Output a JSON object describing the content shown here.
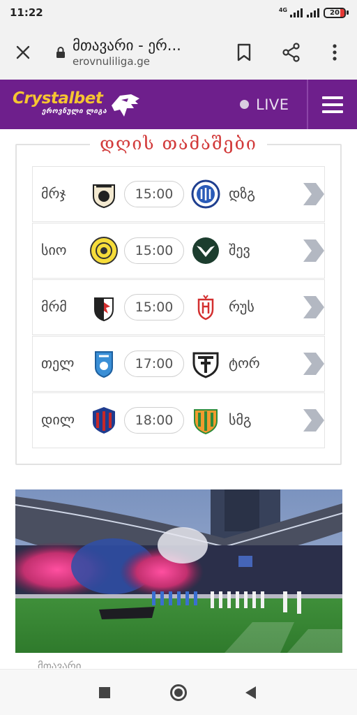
{
  "status_bar": {
    "time": "11:22",
    "network": "4G",
    "battery": "20"
  },
  "browser": {
    "page_title": "მთავარი - ერ...",
    "url": "erovnuliliga.ge"
  },
  "site_header": {
    "brand": "Crystalbet",
    "brand_subtitle": "ეროვნული ლიგა",
    "live_label": "LIVE",
    "colors": {
      "header_bg": "#6e1f8c",
      "brand_yellow": "#f6c531"
    }
  },
  "matches": {
    "title": "დღის თამაშები",
    "rows": [
      {
        "home": "მრჯ",
        "time": "15:00",
        "away": "დზგ"
      },
      {
        "home": "სიო",
        "time": "15:00",
        "away": "შევ"
      },
      {
        "home": "მრმ",
        "time": "15:00",
        "away": "რუს"
      },
      {
        "home": "თელ",
        "time": "17:00",
        "away": "ტორ"
      },
      {
        "home": "დილ",
        "time": "18:00",
        "away": "სმგ"
      }
    ]
  },
  "photo": {
    "icon": "stadium-photo"
  },
  "below_photo_label": "მთავარი",
  "nav": {
    "icons": [
      "recents-square-icon",
      "home-circle-icon",
      "back-triangle-icon"
    ]
  }
}
